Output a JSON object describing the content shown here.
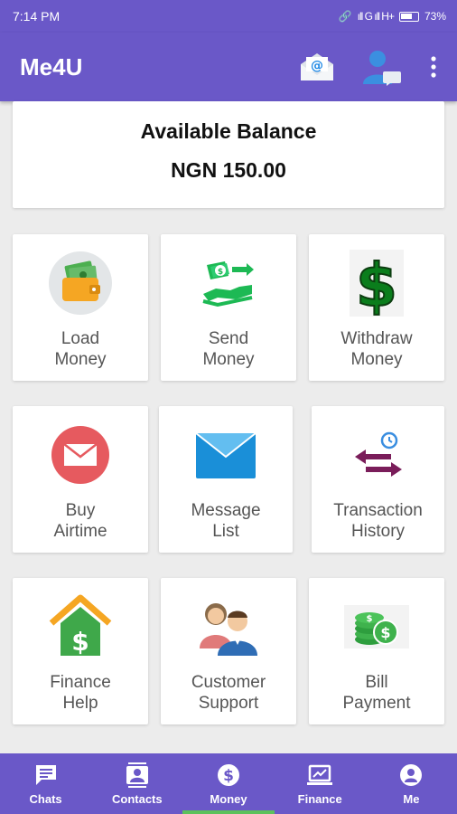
{
  "status_bar": {
    "time": "7:14 PM",
    "signal_text": "ıll G ıll H+",
    "battery_percent": "73%"
  },
  "app_bar": {
    "title": "Me4U",
    "actions": [
      "mail-at-icon",
      "profile-chat-icon",
      "more-vert-icon"
    ]
  },
  "balance": {
    "label": "Available Balance",
    "value": "NGN 150.00"
  },
  "tiles": [
    {
      "label_1": "Load",
      "label_2": "Money",
      "icon": "wallet-icon"
    },
    {
      "label_1": "Send",
      "label_2": "Money",
      "icon": "send-money-icon"
    },
    {
      "label_1": "Withdraw",
      "label_2": "Money",
      "icon": "dollar-sign-icon"
    },
    {
      "label_1": "Buy",
      "label_2": "Airtime",
      "icon": "envelope-circle-icon"
    },
    {
      "label_1": "Message",
      "label_2": "List",
      "icon": "envelope-icon"
    },
    {
      "label_1": "Transaction",
      "label_2": "History",
      "icon": "transfer-arrows-icon"
    },
    {
      "label_1": "Finance",
      "label_2": "Help",
      "icon": "house-dollar-icon"
    },
    {
      "label_1": "Customer",
      "label_2": "Support",
      "icon": "support-people-icon"
    },
    {
      "label_1": "Bill",
      "label_2": "Payment",
      "icon": "coins-icon"
    }
  ],
  "bottom_nav": [
    {
      "label": "Chats",
      "icon": "chat-icon"
    },
    {
      "label": "Contacts",
      "icon": "contacts-icon"
    },
    {
      "label": "Money",
      "icon": "dollar-circle-icon",
      "active": true
    },
    {
      "label": "Finance",
      "icon": "chart-icon"
    },
    {
      "label": "Me",
      "icon": "person-icon"
    }
  ],
  "colors": {
    "primary": "#6a58c8",
    "active_indicator": "#5cc15c",
    "background": "#ececec"
  }
}
